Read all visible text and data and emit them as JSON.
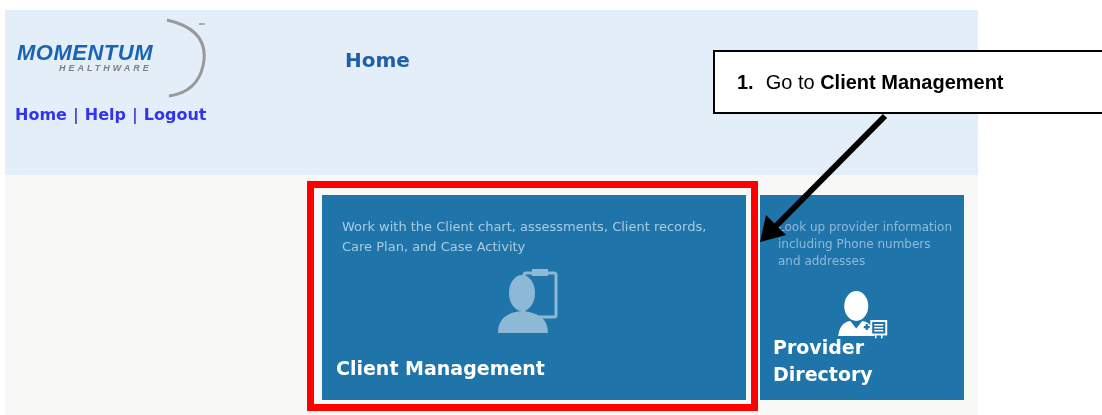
{
  "header": {
    "logo": {
      "name": "MOMENTUM",
      "tagline": "HEALTHWARE"
    },
    "title": "Home",
    "nav_items": [
      {
        "kind": "link",
        "text": "Home"
      },
      {
        "kind": "separator",
        "text": "|"
      },
      {
        "kind": "link",
        "text": "Help"
      },
      {
        "kind": "separator",
        "text": "|"
      },
      {
        "kind": "link",
        "text": "Logout"
      }
    ]
  },
  "tiles": [
    {
      "kind": "client",
      "title": "Client Management",
      "description": "Work with the Client chart, assessments, Client records, Care Plan, and Case Activity",
      "highlighted": true
    },
    {
      "kind": "provider",
      "title": "Provider Directory",
      "description": "Look up provider information including Phone numbers and addresses",
      "highlighted": false
    }
  ],
  "callout": {
    "step": "1.",
    "text": "Go to **Client Management**"
  }
}
